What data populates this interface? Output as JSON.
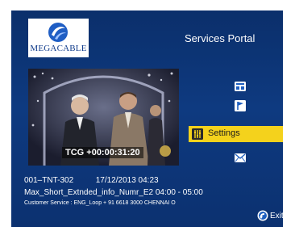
{
  "brand": {
    "logo_text": "MEGACABLE",
    "logo_icon": "megacable-swirl-logo"
  },
  "portal": {
    "title": "Services Portal"
  },
  "video": {
    "timecode": "TCG +00:00:31:20",
    "watermark_icon": "channel-badge-icon"
  },
  "menu": {
    "items": [
      {
        "id": "tv-guide",
        "icon": "tv-guide-icon",
        "label": ""
      },
      {
        "id": "flag",
        "icon": "flag-icon",
        "label": ""
      },
      {
        "id": "settings",
        "icon": "settings-icon",
        "label": "Settings",
        "selected": true
      },
      {
        "id": "mail",
        "icon": "mail-icon",
        "label": ""
      }
    ]
  },
  "info": {
    "channel": "001–TNT-302",
    "datetime": "17/12/2013 04:23",
    "program": "Max_Short_Extnded_info_Numr_E2 04:00 - 05:00",
    "customer_service": "Customer Service : ENG_Loop + 91 6618 3000 CHENNAI O"
  },
  "exit": {
    "label": "Exit",
    "icon": "exit-icon"
  },
  "colors": {
    "background": "#0e3a80",
    "highlight": "#f4d21c",
    "text": "#ffffff",
    "icon_blue": "#1e5fc0"
  }
}
